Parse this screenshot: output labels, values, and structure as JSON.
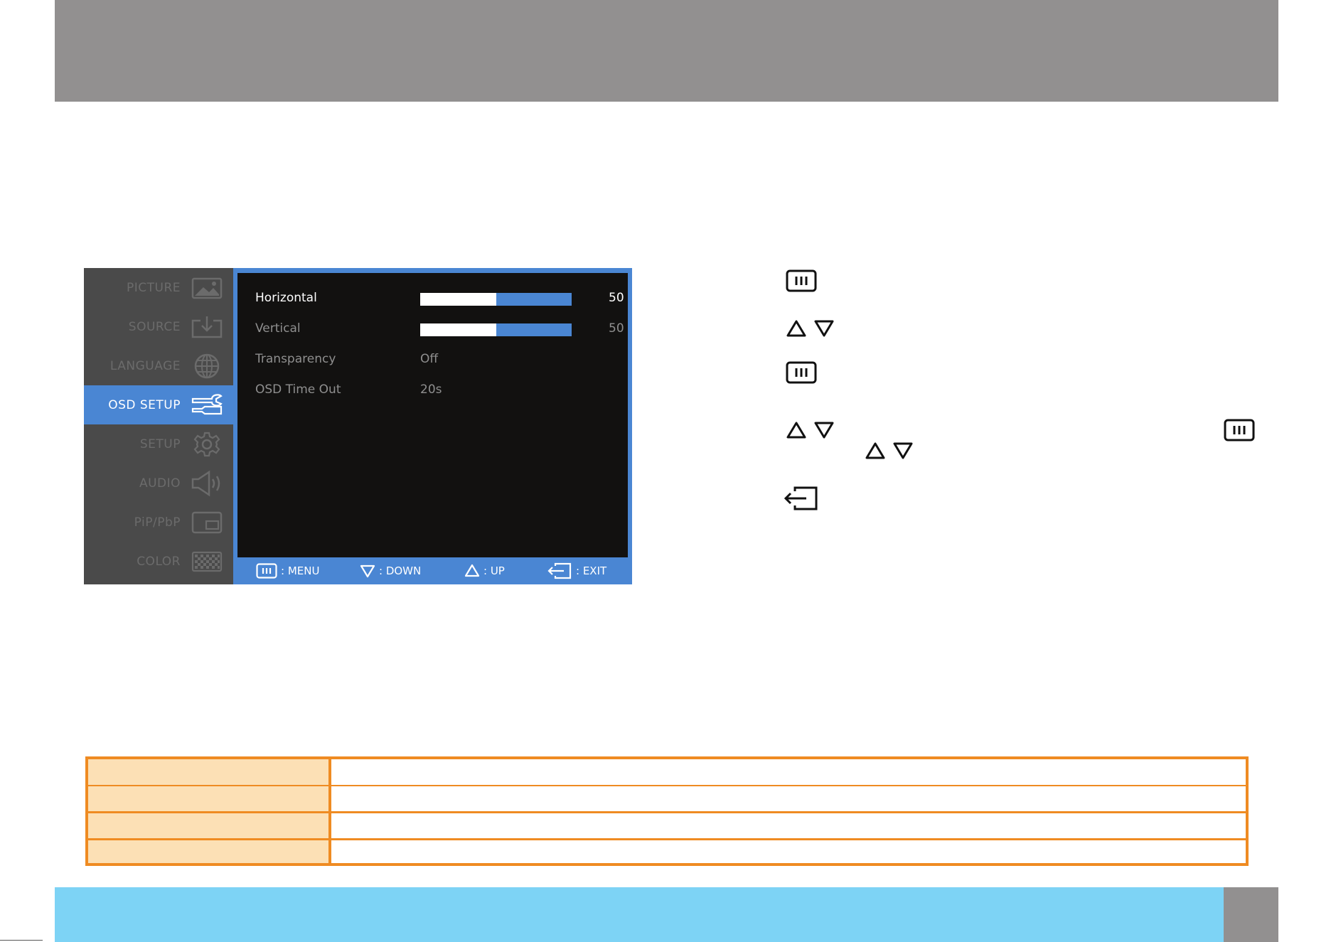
{
  "osd": {
    "sidebar": {
      "items": [
        {
          "label": "PICTURE",
          "icon": "picture-icon"
        },
        {
          "label": "SOURCE",
          "icon": "source-icon"
        },
        {
          "label": "LANGUAGE",
          "icon": "globe-icon"
        },
        {
          "label": "OSD SETUP",
          "icon": "wrench-icon",
          "active": true
        },
        {
          "label": "SETUP",
          "icon": "gear-icon"
        },
        {
          "label": "AUDIO",
          "icon": "speaker-icon"
        },
        {
          "label": "PiP/PbP",
          "icon": "pip-icon"
        },
        {
          "label": "COLOR",
          "icon": "color-grid-icon"
        }
      ]
    },
    "settings": [
      {
        "label": "Horizontal",
        "value": "50",
        "level": 0.5,
        "type": "slider",
        "selected": true
      },
      {
        "label": "Vertical",
        "value": "50",
        "level": 0.5,
        "type": "slider"
      },
      {
        "label": "Transparency",
        "value": "Off",
        "type": "value"
      },
      {
        "label": "OSD Time Out",
        "value": "20s",
        "type": "value"
      }
    ],
    "footer": {
      "menu": ": MENU",
      "down": ": DOWN",
      "up": ": UP",
      "exit": ": EXIT"
    }
  },
  "keys": [
    "menu-key-icon",
    "up-arrow-icon",
    "down-arrow-icon",
    "exit-key-icon"
  ],
  "colors": {
    "accent": "#4a86d3",
    "osd_background": "#121110",
    "sidebar_background": "#4a4a4a",
    "top_band": "#929090",
    "bottom_band": "#7dd3f5",
    "table_border": "#ef8b22",
    "table_header_fill": "#fce0b5"
  }
}
